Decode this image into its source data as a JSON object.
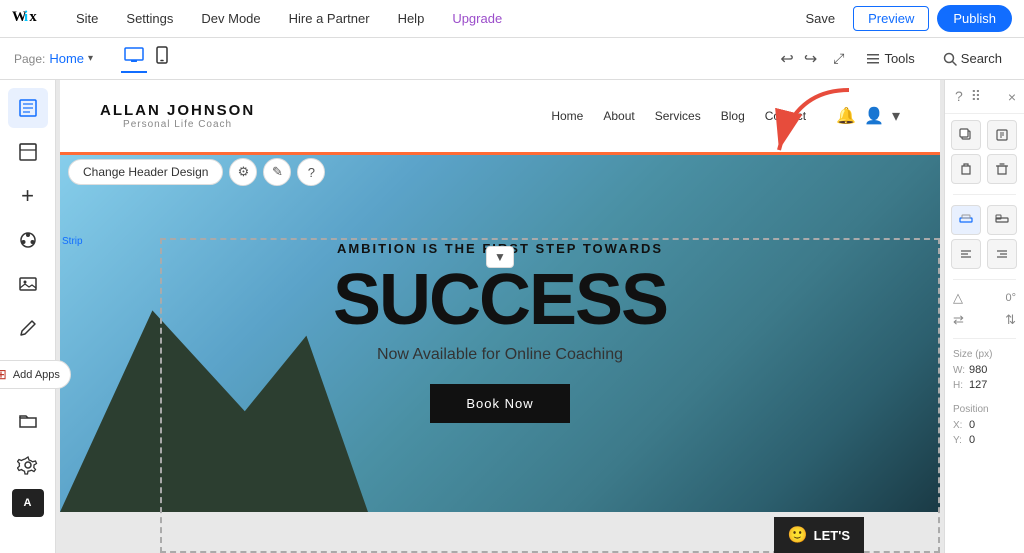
{
  "topbar": {
    "logo": "WiX",
    "menu_items": [
      "Site",
      "Settings",
      "Dev Mode",
      "Hire a Partner",
      "Help",
      "Upgrade"
    ],
    "upgrade_label": "Upgrade",
    "save_label": "Save",
    "preview_label": "Preview",
    "publish_label": "Publish"
  },
  "secondarybar": {
    "page_label": "Page:",
    "page_name": "Home",
    "device_desktop_label": "Desktop",
    "device_mobile_label": "Mobile",
    "tools_label": "Tools",
    "search_label": "Search"
  },
  "sidebar": {
    "icons": [
      {
        "name": "pages-icon",
        "symbol": "☰"
      },
      {
        "name": "sections-icon",
        "symbol": "⬜"
      },
      {
        "name": "add-icon",
        "symbol": "+"
      },
      {
        "name": "theme-icon",
        "symbol": "✦"
      },
      {
        "name": "media-icon",
        "symbol": "🖼"
      },
      {
        "name": "blog-icon",
        "symbol": "✒"
      },
      {
        "name": "apps-icon",
        "symbol": "⚙"
      },
      {
        "name": "wix-stores-icon",
        "symbol": "A"
      }
    ],
    "add_apps_label": "Add Apps"
  },
  "site": {
    "logo_name": "ALLAN JOHNSON",
    "logo_sub": "Personal Life Coach",
    "nav_links": [
      "Home",
      "About",
      "Services",
      "Blog",
      "Contact"
    ],
    "header_strip_label": "Strip",
    "change_header_label": "Change Header Design"
  },
  "hero": {
    "tagline": "AMBITION IS THE FIRST STEP TOWARDS",
    "title": "SUCCESS",
    "subtitle": "Now Available for Online Coaching",
    "cta_label": "Book Now"
  },
  "right_panel": {
    "close_label": "×",
    "size_label": "Size (px)",
    "width_label": "W:",
    "width_value": "980",
    "height_label": "H:",
    "height_value": "127",
    "position_label": "Position",
    "x_label": "X:",
    "x_value": "0",
    "y_label": "Y:",
    "y_value": "0"
  },
  "colors": {
    "accent": "#116dff",
    "publish_bg": "#116dff",
    "orange_border": "#ff6b35",
    "hero_text": "#111111"
  }
}
